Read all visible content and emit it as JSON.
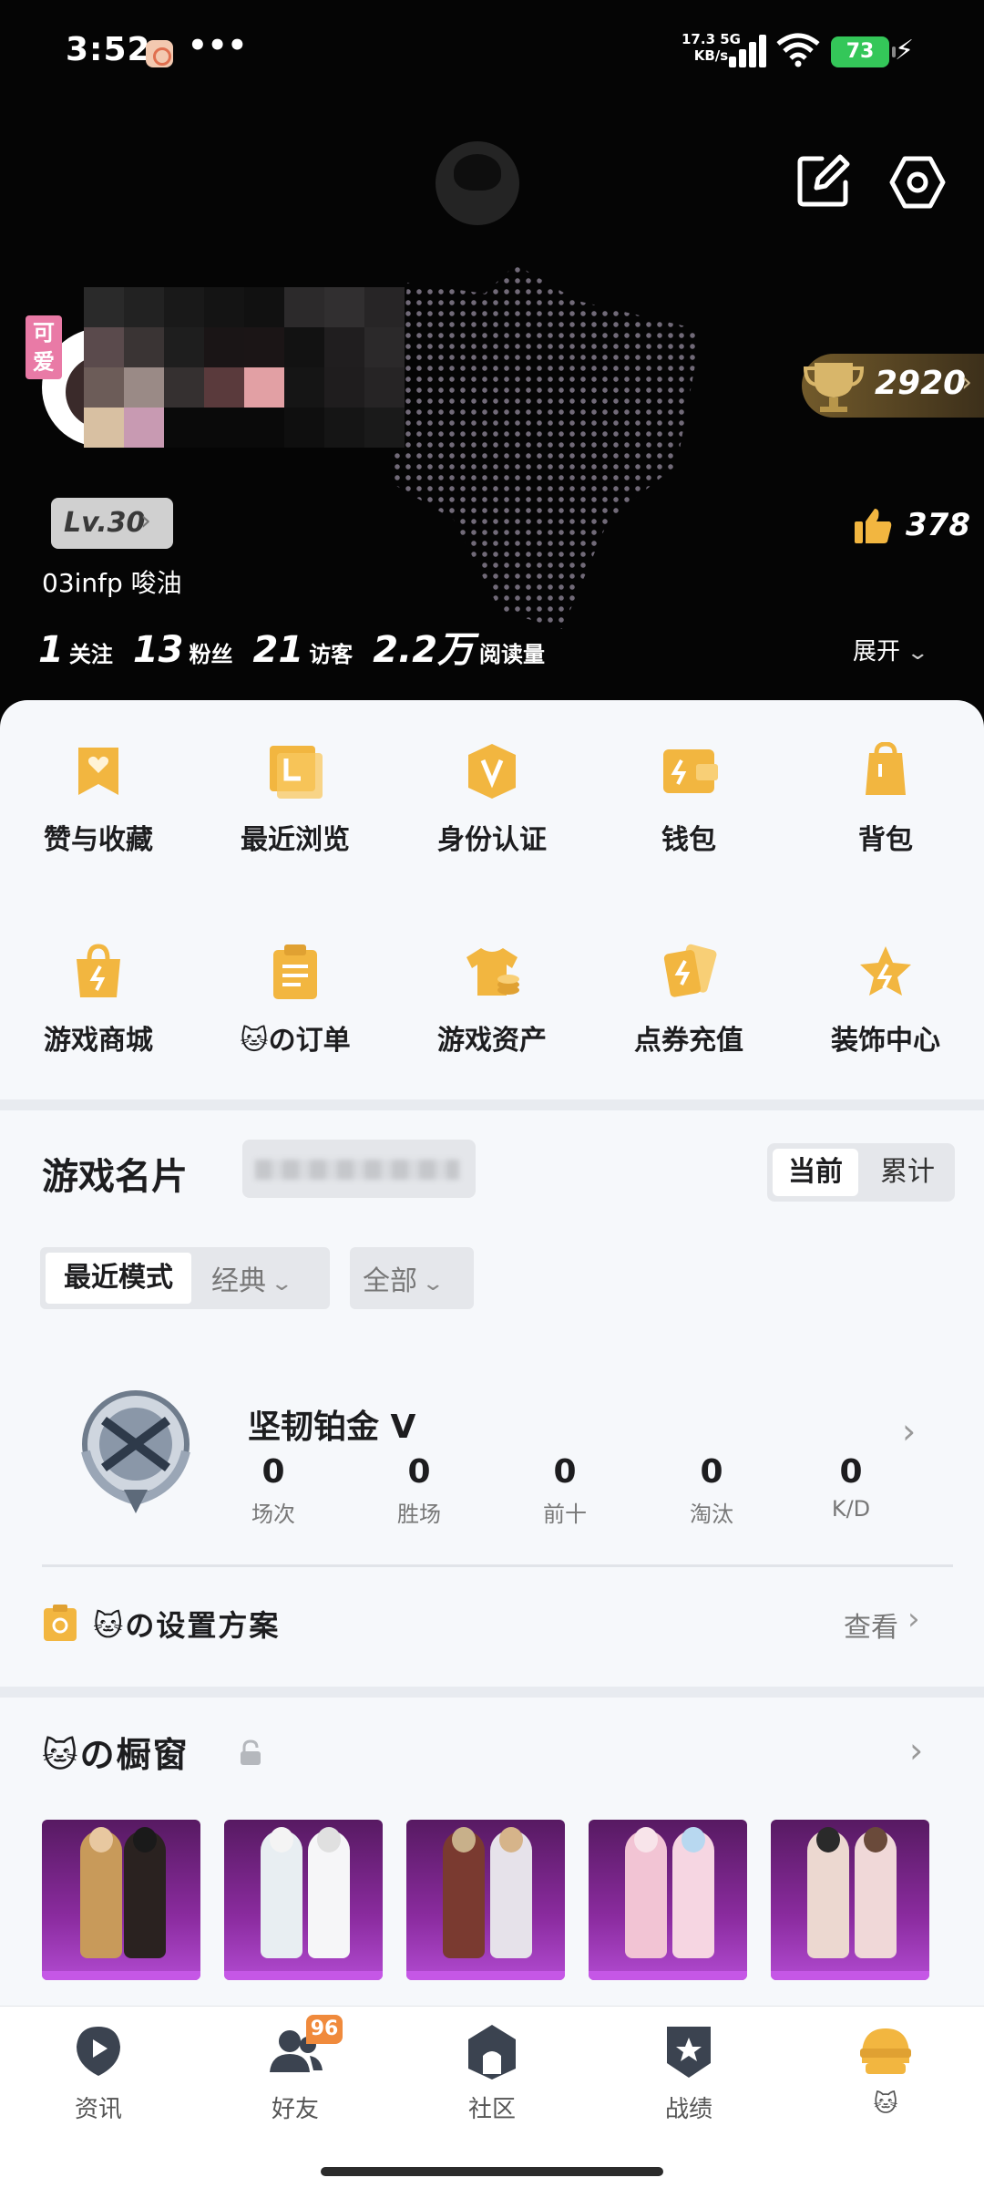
{
  "status_bar": {
    "time": "3:52",
    "dots": "•••",
    "net_speed_top": "17.3 5G",
    "net_speed_bottom": "KB/s",
    "battery": "73"
  },
  "profile": {
    "cute_tag": "可爱",
    "trophy_score": "2920",
    "level": "Lv.30",
    "likes": "378",
    "bio": "03infp 唆油",
    "stats": [
      {
        "value": "1",
        "label": "关注"
      },
      {
        "value": "13",
        "label": "粉丝"
      },
      {
        "value": "21",
        "label": "访客"
      },
      {
        "value": "2.2万",
        "label": "阅读量"
      }
    ],
    "expand": "展开"
  },
  "menu": [
    {
      "label": "赞与收藏",
      "icon": "heart-bookmark-icon"
    },
    {
      "label": "最近浏览",
      "icon": "history-icon"
    },
    {
      "label": "身份认证",
      "icon": "verified-badge-icon"
    },
    {
      "label": "钱包",
      "icon": "wallet-icon"
    },
    {
      "label": "背包",
      "icon": "backpack-icon"
    },
    {
      "label": "游戏商城",
      "icon": "shopping-bag-icon"
    },
    {
      "label": "の订单",
      "icon": "clipboard-icon"
    },
    {
      "label": "游戏资产",
      "icon": "tshirt-coin-icon"
    },
    {
      "label": "点券充值",
      "icon": "coupon-card-icon"
    },
    {
      "label": "装饰中心",
      "icon": "star-icon"
    }
  ],
  "game_card": {
    "title": "游戏名片",
    "toggle_current": "当前",
    "toggle_total": "累计",
    "mode_recent": "最近模式",
    "mode_classic": "经典",
    "filter_all": "全部",
    "rank_title": "坚韧铂金 V",
    "rank_stats": [
      {
        "value": "0",
        "label": "场次"
      },
      {
        "value": "0",
        "label": "胜场"
      },
      {
        "value": "0",
        "label": "前十"
      },
      {
        "value": "0",
        "label": "淘汰"
      },
      {
        "value": "0",
        "label": "K/D"
      }
    ],
    "setup_label": "の设置方案",
    "setup_view": "查看"
  },
  "showcase": {
    "title": "の橱窗"
  },
  "bottom_nav": [
    {
      "label": "资讯",
      "icon": "news-play-icon"
    },
    {
      "label": "好友",
      "icon": "friends-icon"
    },
    {
      "label": "社区",
      "icon": "community-icon"
    },
    {
      "label": "战绩",
      "icon": "record-shield-icon"
    },
    {
      "label": "",
      "icon": "helmet-icon"
    }
  ],
  "friends_badge": "96",
  "colors": {
    "accent_gold": "#f2b640",
    "header_bg": "#050505",
    "outfit_purple": "#8a2b9e",
    "badge_orange": "#f08a3c"
  }
}
